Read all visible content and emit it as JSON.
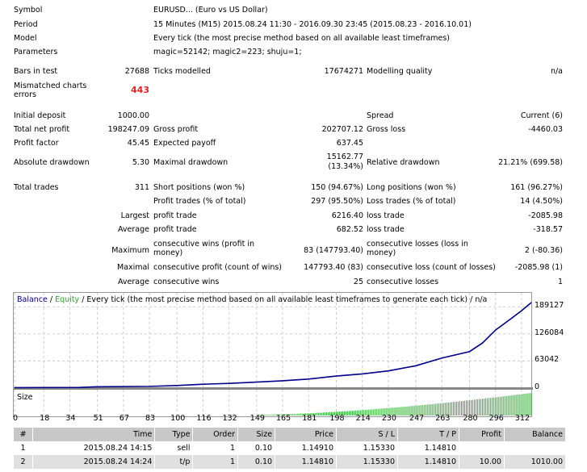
{
  "summary": {
    "symbol_label": "Symbol",
    "symbol": "EURUSD... (Euro vs US Dollar)",
    "period_label": "Period",
    "period": "15 Minutes (M15) 2015.08.24 11:30 - 2016.09.30 23:45 (2015.08.23 - 2016.10.01)",
    "model_label": "Model",
    "model": "Every tick (the most precise method based on all available least timeframes)",
    "parameters_label": "Parameters",
    "parameters": "magic=52142; magic2=223; shuju=1;",
    "bars_label": "Bars in test",
    "bars": "27688",
    "ticks_label": "Ticks modelled",
    "ticks": "17674271",
    "quality_label": "Modelling quality",
    "quality": "n/a",
    "mismatch_label": "Mismatched charts errors",
    "mismatch": "443",
    "deposit_label": "Initial deposit",
    "deposit": "1000.00",
    "spread_label": "Spread",
    "spread": "Current (6)",
    "net_label": "Total net profit",
    "net": "198247.09",
    "gross_profit_label": "Gross profit",
    "gross_profit": "202707.12",
    "gross_loss_label": "Gross loss",
    "gross_loss": "-4460.03",
    "pf_label": "Profit factor",
    "pf": "45.45",
    "payoff_label": "Expected payoff",
    "payoff": "637.45",
    "abs_dd_label": "Absolute drawdown",
    "abs_dd": "5.30",
    "max_dd_label": "Maximal drawdown",
    "max_dd": "15162.77",
    "max_dd_pct": "(13.34%)",
    "rel_dd_label": "Relative drawdown",
    "rel_dd": "21.21% (699.58)",
    "trades_label": "Total trades",
    "trades": "311",
    "short_label": "Short positions (won %)",
    "short": "150 (94.67%)",
    "long_label": "Long positions (won %)",
    "long": "161 (96.27%)",
    "profit_trades_label": "Profit trades (% of total)",
    "profit_trades": "297 (95.50%)",
    "loss_trades_label": "Loss trades (% of total)",
    "loss_trades": "14 (4.50%)",
    "largest": "Largest",
    "largest_profit_label": "profit trade",
    "largest_profit": "6216.40",
    "largest_loss_label": "loss trade",
    "largest_loss": "-2085.98",
    "average": "Average",
    "avg_profit_label": "profit trade",
    "avg_profit": "682.52",
    "avg_loss_label": "loss trade",
    "avg_loss": "-318.57",
    "maximum": "Maximum",
    "max_wins_label": "consecutive wins (profit in money)",
    "max_wins": "83 (147793.40)",
    "max_losses_label": "consecutive losses (loss in money)",
    "max_losses": "2 (-80.36)",
    "maximal": "Maximal",
    "maximal_profit_label": "consecutive profit (count of wins)",
    "maximal_profit": "147793.40 (83)",
    "maximal_loss_label": "consecutive loss (count of losses)",
    "maximal_loss": "-2085.98 (1)",
    "average2": "Average",
    "avg_wins_label": "consecutive wins",
    "avg_wins": "25",
    "avg_losses_label": "consecutive losses",
    "avg_losses": "1"
  },
  "chart_data": {
    "type": "line",
    "legend_balance": "Balance",
    "legend_sep1": " / ",
    "legend_equity": "Equity",
    "legend_rest": " / Every tick (the most precise method based on all available least timeframes to generate each tick) / n/a",
    "size_label": "Size",
    "y_ticks": [
      "189127",
      "126084",
      "63042",
      "0"
    ],
    "y_tick_values": [
      189127,
      126084,
      63042,
      0
    ],
    "x_ticks": [
      "0",
      "18",
      "34",
      "51",
      "67",
      "83",
      "100",
      "116",
      "132",
      "149",
      "165",
      "181",
      "198",
      "214",
      "230",
      "247",
      "263",
      "280",
      "296",
      "312"
    ],
    "xlim": [
      0,
      318
    ],
    "ylim": [
      0,
      199000
    ],
    "balance": [
      [
        0,
        1000
      ],
      [
        40,
        1500
      ],
      [
        50,
        3000
      ],
      [
        83,
        4000
      ],
      [
        100,
        6000
      ],
      [
        116,
        9000
      ],
      [
        132,
        11000
      ],
      [
        149,
        14000
      ],
      [
        165,
        17000
      ],
      [
        181,
        21000
      ],
      [
        198,
        28000
      ],
      [
        214,
        33000
      ],
      [
        230,
        40000
      ],
      [
        247,
        52000
      ],
      [
        263,
        70000
      ],
      [
        280,
        85000
      ],
      [
        288,
        105000
      ],
      [
        296,
        135000
      ],
      [
        305,
        160000
      ],
      [
        312,
        180000
      ],
      [
        318,
        199000
      ]
    ],
    "size_start": 150,
    "colors": {
      "balance": "#00008b",
      "equity": "#2aa52a",
      "size": "#2db52d"
    }
  },
  "table": {
    "headers": [
      "#",
      "Time",
      "Type",
      "Order",
      "Size",
      "Price",
      "S / L",
      "T / P",
      "Profit",
      "Balance"
    ],
    "rows": [
      [
        "1",
        "2015.08.24 14:15",
        "sell",
        "1",
        "0.10",
        "1.14910",
        "1.15330",
        "1.14810",
        "",
        ""
      ],
      [
        "2",
        "2015.08.24 14:24",
        "t/p",
        "1",
        "0.10",
        "1.14810",
        "1.15330",
        "1.14810",
        "10.00",
        "1010.00"
      ]
    ]
  }
}
